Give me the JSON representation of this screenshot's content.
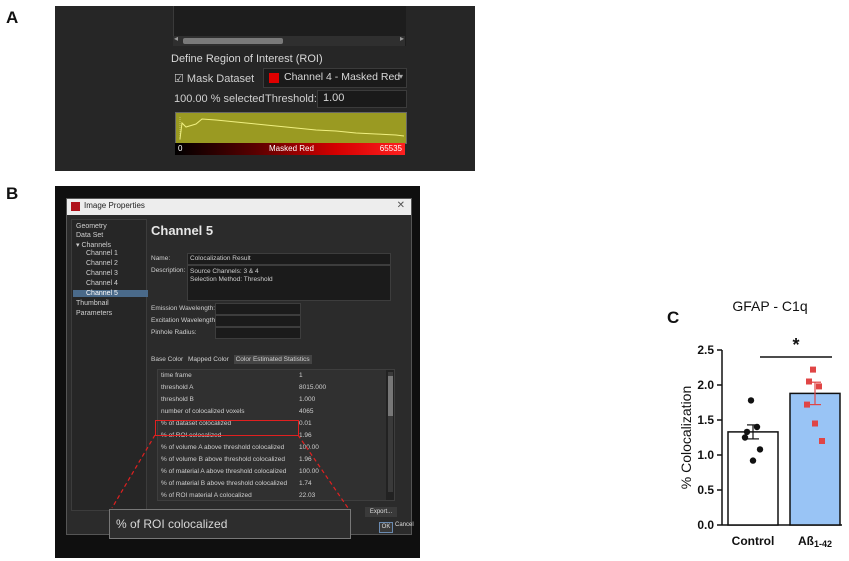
{
  "panels": {
    "a": "A",
    "b": "B",
    "c": "C"
  },
  "panelA": {
    "roi_title": "Define Region of Interest (ROI)",
    "mask_label": "☑ Mask Dataset",
    "channel_select": "Channel 4 - Masked Red",
    "selected": "100.00 % selected",
    "threshold_label": "Threshold:",
    "threshold_value": "1.00",
    "gradient": {
      "min": "0",
      "label": "Masked Red",
      "max": "65535"
    },
    "colors": {
      "channel_swatch": "#e00000",
      "histogram": "#9a9a22",
      "curve": "#f0f080"
    }
  },
  "panelB": {
    "window_title": "Image Properties",
    "tree": [
      "Geometry",
      "Data Set",
      "Channels",
      "Channel 1",
      "Channel 2",
      "Channel 3",
      "Channel 4",
      "Channel 5",
      "Thumbnail",
      "Parameters"
    ],
    "selected_tree_item": "Channel 5",
    "channel_title": "Channel 5",
    "name_label": "Name:",
    "name_value": "Colocalization Result",
    "desc_label": "Description:",
    "desc_line1": "Source Channels: 3 & 4",
    "desc_line2": "Selection Method: Threshold",
    "emission_label": "Emission Wavelength:",
    "excitation_label": "Excitation Wavelength:",
    "pinhole_label": "Pinhole Radius:",
    "tabs": [
      "Base Color",
      "Mapped Color",
      "Color Estimated Statistics"
    ],
    "stats": [
      {
        "k": "time frame",
        "v": "1"
      },
      {
        "k": "threshold A",
        "v": "8015.000"
      },
      {
        "k": "threshold B",
        "v": "1.000"
      },
      {
        "k": "number of colocalized voxels",
        "v": "4065"
      },
      {
        "k": "% of dataset colocalized",
        "v": "0.01"
      },
      {
        "k": "% of ROI colocalized",
        "v": "1.96"
      },
      {
        "k": "% of volume A above threshold colocalized",
        "v": "100.00"
      },
      {
        "k": "% of volume B above threshold colocalized",
        "v": "1.96"
      },
      {
        "k": "% of material A above threshold colocalized",
        "v": "100.00"
      },
      {
        "k": "% of material B above threshold colocalized",
        "v": "1.74"
      },
      {
        "k": "% of ROI material A colocalized",
        "v": "22.03"
      }
    ],
    "export_label": "Export...",
    "ok_label": "OK",
    "cancel_label": "Cancel",
    "zoom_text": "% of ROI colocalized",
    "highlight_color": "#e02020"
  },
  "chart_data": {
    "type": "bar",
    "title": "GFAP - C1q",
    "ylabel": "% Colocalization",
    "categories": [
      "Control",
      "Aß1-42"
    ],
    "category_main": [
      "Control",
      "Aß"
    ],
    "category_sub": [
      "",
      "1-42"
    ],
    "values": [
      1.33,
      1.88
    ],
    "errors": [
      0.1,
      0.16
    ],
    "points": [
      [
        1.78,
        1.33,
        1.4,
        1.25,
        0.92,
        1.08
      ],
      [
        2.22,
        2.05,
        1.98,
        1.72,
        1.45,
        1.2
      ]
    ],
    "colors": [
      "#ffffff",
      "#99c4f5"
    ],
    "point_colors": [
      "#111111",
      "#e04545"
    ],
    "ylim": [
      0.0,
      2.5
    ],
    "yticks": [
      "0.0",
      "0.5",
      "1.0",
      "1.5",
      "2.0",
      "2.5"
    ],
    "significance": "*"
  }
}
